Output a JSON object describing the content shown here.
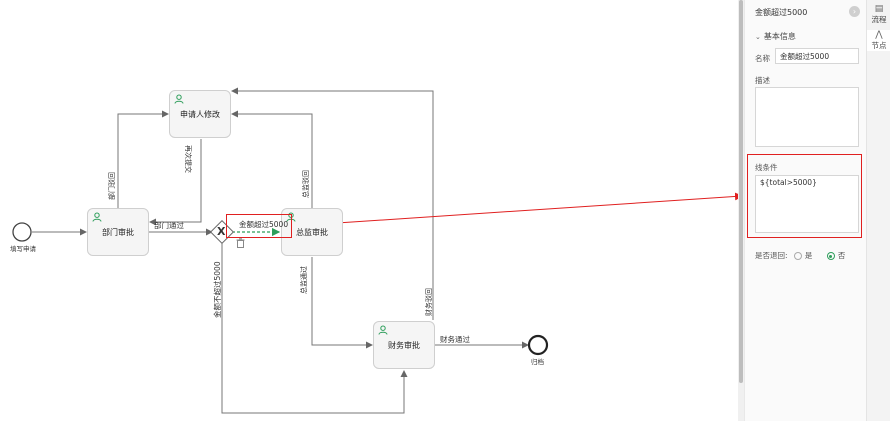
{
  "diagram": {
    "start_label": "填写申请",
    "end_label": "归档",
    "tasks": {
      "applicant_modify": "申请人修改",
      "dept_approve": "部门审批",
      "director_approve": "总监审批",
      "finance_approve": "财务审批"
    },
    "gateway_symbol": "X",
    "edges": {
      "dept_reject": "部门驳回",
      "resubmit": "再次提交",
      "dept_pass": "部门通过",
      "amount_over": "金额超过5000",
      "amount_not_over": "金额不超过5000",
      "director_reject": "总监驳回",
      "director_pass": "总监通过",
      "finance_reject": "财务驳回",
      "finance_pass": "财务通过"
    },
    "colors": {
      "selected_edge": "#2e9e5b",
      "highlight": "#e02020",
      "user_icon": "#2e9e5b"
    }
  },
  "panel": {
    "title": "金额超过5000",
    "section": "基本信息",
    "name_label": "名称",
    "name_value": "金额超过5000",
    "desc_label": "描述",
    "desc_value": "",
    "condition_label": "线条件",
    "condition_value": "${total>5000}",
    "rollback_label": "是否退回:",
    "opt_yes": "是",
    "opt_no": "否",
    "selected_option": "否"
  },
  "side_tabs": {
    "flow": "流程",
    "node": "节点"
  },
  "icons": {
    "flow_tab": "document-icon",
    "node_tab": "nodes-icon",
    "panel_nav": "arrow-right-icon",
    "delete": "trash-icon",
    "user": "user-icon"
  }
}
